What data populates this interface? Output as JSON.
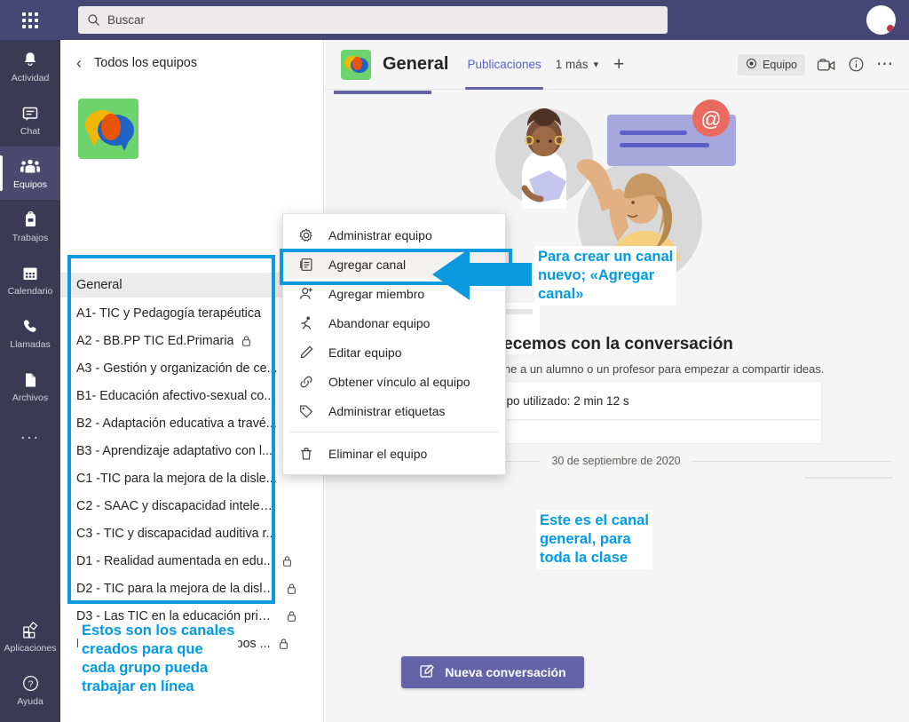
{
  "topbar": {
    "waffle_label": "app-launcher",
    "search_placeholder": "Buscar",
    "search_value": ""
  },
  "rail": {
    "items": [
      {
        "label": "Actividad",
        "icon": "bell-icon",
        "active": false
      },
      {
        "label": "Chat",
        "icon": "chat-icon",
        "active": false
      },
      {
        "label": "Equipos",
        "icon": "teams-icon",
        "active": true
      },
      {
        "label": "Trabajos",
        "icon": "backpack-icon",
        "active": false
      },
      {
        "label": "Calendario",
        "icon": "calendar-icon",
        "active": false
      },
      {
        "label": "Llamadas",
        "icon": "phone-icon",
        "active": false
      },
      {
        "label": "Archivos",
        "icon": "file-icon",
        "active": false
      }
    ],
    "more_label": "...",
    "bottom": [
      {
        "label": "Aplicaciones",
        "icon": "apps-icon"
      },
      {
        "label": "Ayuda",
        "icon": "help-icon"
      }
    ]
  },
  "teampanel": {
    "back_label": "Todos los equipos",
    "team_logo": "team-avatar-speech-bubbles",
    "more_button": "...",
    "general_channel": "General",
    "channels": [
      {
        "name": "A1- TIC y Pedagogía terapéutica ",
        "private": false
      },
      {
        "name": "A2 - BB.PP TIC Ed.Primaria",
        "private": true
      },
      {
        "name": "A3 - Gestión y organización de ce...",
        "private": false
      },
      {
        "name": "B1- Educación afectivo-sexual co...",
        "private": false
      },
      {
        "name": "B2 - Adaptación educativa a travé...",
        "private": false
      },
      {
        "name": "B3 - Aprendizaje adaptativo con l...",
        "private": false
      },
      {
        "name": "C1 -TIC para la mejora de la disle...",
        "private": false
      },
      {
        "name": "C2 - SAAC y discapacidad intelect...",
        "private": false
      },
      {
        "name": "C3 - TIC y discapacidad auditiva r...",
        "private": false
      },
      {
        "name": "D1 - Realidad aumentada en edu...",
        "private": true
      },
      {
        "name": "D2 - TIC para la mejora de la disle...",
        "private": true
      },
      {
        "name": "D3 - Las TIC en la educación prim...",
        "private": true
      },
      {
        "name": "D4 -Eduación online en tiempos ...",
        "private": true
      }
    ]
  },
  "main": {
    "channel_title": "General",
    "tabs": [
      {
        "label": "Publicaciones",
        "active": true
      },
      {
        "label": "1 más",
        "active": false,
        "has_chevron": true
      }
    ],
    "add_tab": "+",
    "team_pill": "Equipo",
    "meet_icon": "meet-now-icon",
    "info_icon": "info-icon",
    "more_icon": "more-options-icon",
    "conversation_title": "Empecemos con la conversación",
    "conversation_sub": "Mencione a un alumno o un profesor para empezar a compartir ideas.",
    "info_card_text": "Tiempo utilizado: 2 min 12 s",
    "date_divider": "30 de septiembre de 2020",
    "new_conversation_label": "Nueva conversación",
    "at_symbol": "@"
  },
  "context_menu": {
    "items": [
      {
        "label": "Administrar equipo",
        "icon": "gear-icon",
        "highlighted": false
      },
      {
        "label": "Agregar canal",
        "icon": "add-channel-icon",
        "highlighted": true
      },
      {
        "label": "Agregar miembro",
        "icon": "add-member-icon",
        "highlighted": false
      },
      {
        "label": "Abandonar equipo",
        "icon": "leave-team-icon",
        "highlighted": false
      },
      {
        "label": "Editar equipo",
        "icon": "pencil-icon",
        "highlighted": false
      },
      {
        "label": "Obtener vínculo al equipo",
        "icon": "link-icon",
        "highlighted": false
      },
      {
        "label": "Administrar etiquetas",
        "icon": "tag-icon",
        "highlighted": false
      }
    ],
    "delete_item": {
      "label": "Eliminar el equipo",
      "icon": "trash-icon"
    }
  },
  "annotations": {
    "accent_color": "#029ae4",
    "callout_add_channel": "Para crear un canal\nnuevo; «Agregar\ncanal»",
    "callout_general": "Este es el canal\ngeneral, para\ntoda la clase",
    "callout_channels": "Estos son los canales\ncreados para que\ncada grupo pueda\ntrabajar en línea"
  }
}
